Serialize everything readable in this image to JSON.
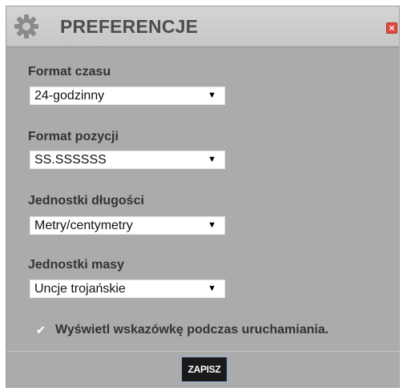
{
  "dialog": {
    "title": "PREFERENCJE",
    "icons": {
      "settings": "gear-icon",
      "close": "close-icon"
    },
    "close_glyph": "×",
    "colors": {
      "close_button": "#dc4b3d",
      "save_button": "#1a1a1a",
      "save_button_border": "#8cb0dc"
    }
  },
  "fields": {
    "time_format": {
      "label": "Format czasu",
      "value": "24-godzinny"
    },
    "position_format": {
      "label": "Format pozycji",
      "value": "SS.SSSSSS"
    },
    "length_units": {
      "label": "Jednostki długości",
      "value": "Metry/centymetry"
    },
    "mass_units": {
      "label": "Jednostki masy",
      "value": "Uncje trojańskie"
    }
  },
  "dropdown_arrow": "▼",
  "startup_tip": {
    "label": "Wyświetl wskazówkę podczas uruchamiania.",
    "checked": true,
    "check_glyph": "✔"
  },
  "footer": {
    "save_label": "ZAPISZ"
  }
}
